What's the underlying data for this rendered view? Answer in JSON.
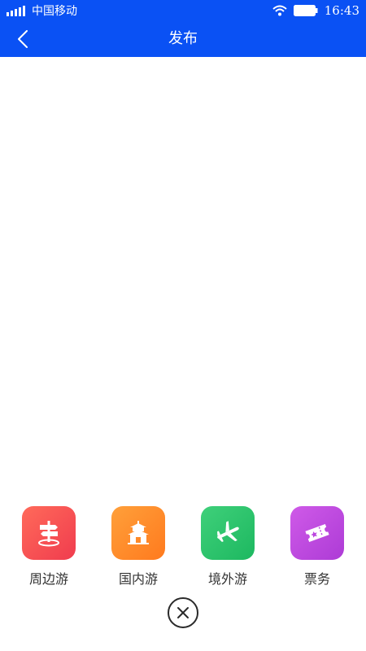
{
  "status_bar": {
    "carrier": "中国移动",
    "time": "16:43"
  },
  "header": {
    "title": "发布"
  },
  "publish_menu": {
    "items": [
      {
        "label": "周边游",
        "icon": "signpost-icon",
        "color_from": "#ff6a5a",
        "color_to": "#f03c4e"
      },
      {
        "label": "国内游",
        "icon": "pagoda-icon",
        "color_from": "#ffa03a",
        "color_to": "#ff7a1e"
      },
      {
        "label": "境外游",
        "icon": "airplane-icon",
        "color_from": "#3fd07a",
        "color_to": "#1db860"
      },
      {
        "label": "票务",
        "icon": "ticket-icon",
        "color_from": "#cf5ae8",
        "color_to": "#ad3bd6"
      }
    ]
  },
  "colors": {
    "brand": "#0a51f4",
    "background": "#ffffff",
    "label": "#333333"
  }
}
